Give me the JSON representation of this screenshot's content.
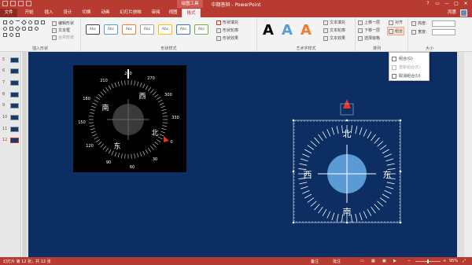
{
  "window": {
    "title": "中期答辩 - PowerPoint",
    "context_tab": "绘图工具",
    "controls": [
      "?",
      "▭",
      "—",
      "□",
      "✕"
    ]
  },
  "tabs": [
    "文件",
    "开始",
    "插入",
    "设计",
    "切换",
    "动画",
    "幻灯片放映",
    "审阅",
    "视图",
    "格式"
  ],
  "user": "凤惠",
  "ribbon": {
    "insert_shapes": {
      "label": "插入形状",
      "edit_shape": "编辑形状",
      "text_box": "文本框",
      "merge_shapes": "合并形状"
    },
    "shape_styles": {
      "label": "形状样式",
      "preset_label": "Abc",
      "fill": "形状填充",
      "outline": "形状轮廓",
      "effects": "形状效果"
    },
    "wordart": {
      "label": "艺术字样式",
      "letter": "A",
      "text_fill": "文本填充",
      "text_outline": "文本轮廓",
      "text_effects": "文本效果"
    },
    "arrange": {
      "label": "排列",
      "bring_forward": "上移一层",
      "send_backward": "下移一层",
      "selection_pane": "选择窗格",
      "align": "对齐",
      "group": "组合",
      "rotate": "旋转"
    },
    "size": {
      "label": "大小",
      "height_label": "高度:",
      "width_label": "宽度:"
    }
  },
  "group_menu": {
    "items": [
      {
        "label": "组合(G)",
        "enabled": true
      },
      {
        "label": "重新组合(E)",
        "enabled": false
      },
      {
        "label": "取消组合(U)",
        "enabled": true
      }
    ]
  },
  "slides_panel": {
    "numbers": [
      "5",
      "6",
      "7",
      "8",
      "9",
      "10",
      "11",
      "12"
    ],
    "active": "12"
  },
  "compass_left": {
    "degrees": [
      "240",
      "270",
      "300",
      "330",
      "0",
      "30",
      "60",
      "90",
      "120",
      "150",
      "180",
      "210"
    ],
    "directions": {
      "north": "北",
      "south": "南",
      "east": "东",
      "west": "西"
    }
  },
  "compass_right": {
    "directions": {
      "north": "北",
      "south": "南",
      "east": "东",
      "west": "西"
    }
  },
  "statusbar": {
    "slide_info": "幻灯片 第 12 张，共 12 张",
    "notes": "备注",
    "comments": "批注",
    "zoom": "95%"
  },
  "colors": {
    "accent": "#b83b32",
    "slide_bg": "#0c2e62",
    "compass_center": "#5b9bd5",
    "marker": "#e8332a"
  }
}
